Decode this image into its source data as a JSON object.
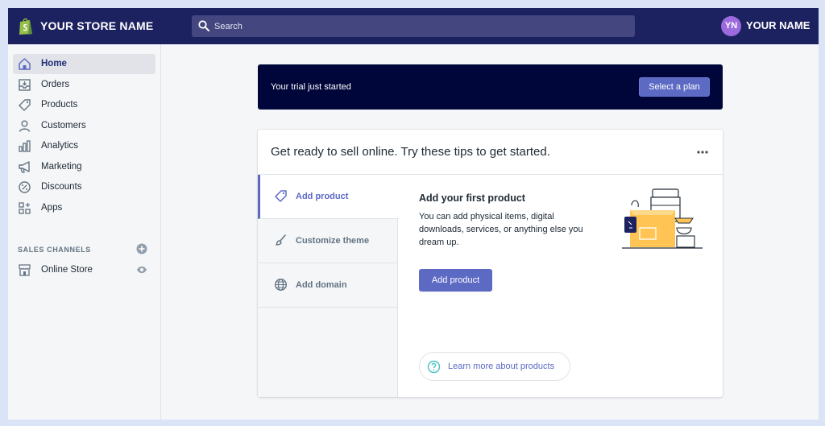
{
  "header": {
    "store_name": "YOUR STORE NAME",
    "search_placeholder": "Search",
    "avatar_initials": "YN",
    "user_name": "YOUR NAME"
  },
  "sidebar": {
    "items": [
      {
        "label": "Home",
        "icon": "home-icon",
        "active": true
      },
      {
        "label": "Orders",
        "icon": "orders-icon"
      },
      {
        "label": "Products",
        "icon": "tag-icon"
      },
      {
        "label": "Customers",
        "icon": "person-icon"
      },
      {
        "label": "Analytics",
        "icon": "bar-chart-icon"
      },
      {
        "label": "Marketing",
        "icon": "megaphone-icon"
      },
      {
        "label": "Discounts",
        "icon": "discount-icon"
      },
      {
        "label": "Apps",
        "icon": "apps-grid-icon"
      }
    ],
    "sales_channels_heading": "SALES CHANNELS",
    "channel": {
      "label": "Online Store",
      "icon": "storefront-icon"
    }
  },
  "trial_banner": {
    "text": "Your trial just started",
    "button_label": "Select a plan"
  },
  "tips_card": {
    "title": "Get ready to sell online. Try these tips to get started.",
    "tabs": [
      {
        "label": "Add product",
        "icon": "tag-icon",
        "active": true
      },
      {
        "label": "Customize theme",
        "icon": "brush-icon"
      },
      {
        "label": "Add domain",
        "icon": "globe-icon"
      }
    ],
    "detail": {
      "title": "Add your first product",
      "description": "You can add physical items, digital downloads, services, or anything else you dream up.",
      "button_label": "Add product",
      "learn_more": "Learn more about products"
    }
  },
  "colors": {
    "topbar": "#1c2260",
    "accent": "#5c6ac4",
    "trial_bg": "#000639",
    "avatar": "#9c6ade"
  }
}
